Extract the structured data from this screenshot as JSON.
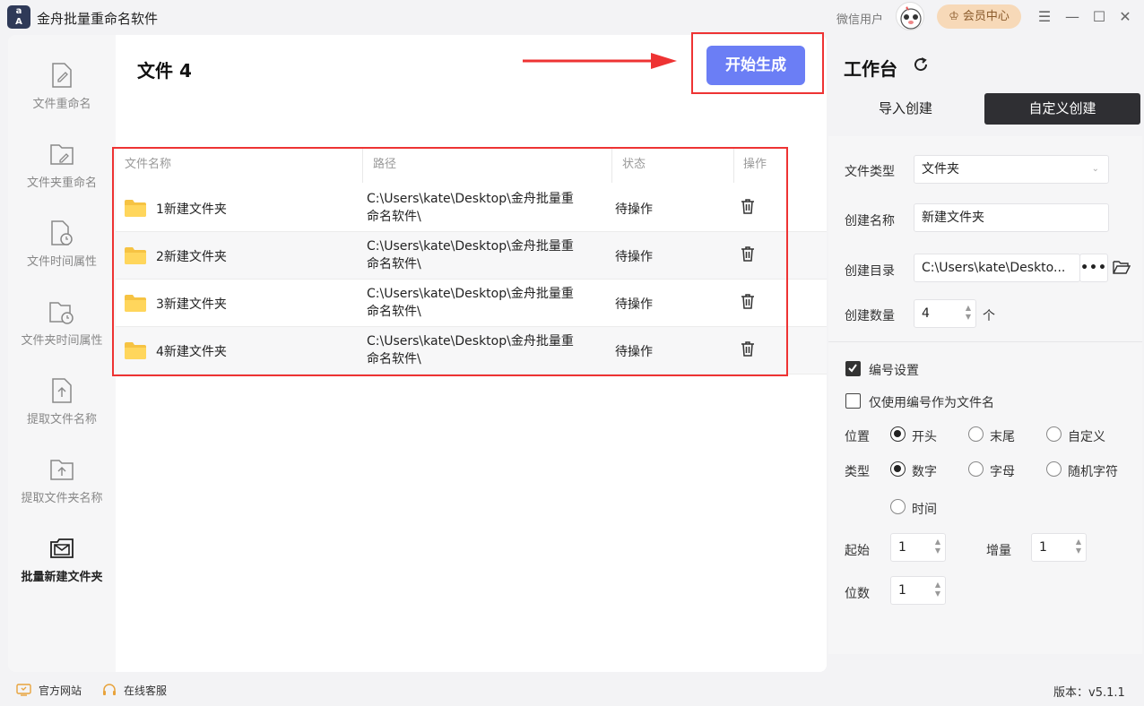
{
  "app": {
    "logo_text": "a\nA",
    "title": "金舟批量重命名软件"
  },
  "header": {
    "user_label": "微信用户",
    "vip_label": "会员中心"
  },
  "sidebar": {
    "items": [
      {
        "label": "文件重命名",
        "icon": "file-edit-icon"
      },
      {
        "label": "文件夹重命名",
        "icon": "folder-edit-icon"
      },
      {
        "label": "文件时间属性",
        "icon": "file-clock-icon"
      },
      {
        "label": "文件夹时间属性",
        "icon": "folder-clock-icon"
      },
      {
        "label": "提取文件名称",
        "icon": "file-extract-icon"
      },
      {
        "label": "提取文件夹名称",
        "icon": "folder-extract-icon"
      },
      {
        "label": "批量新建文件夹",
        "icon": "folder-mail-icon",
        "active": true
      }
    ]
  },
  "main": {
    "title": "文件 4",
    "start_button": "开始生成",
    "columns": [
      "文件名称",
      "路径",
      "状态",
      "操作"
    ],
    "rows": [
      {
        "name": "1新建文件夹",
        "path1": "C:\\Users\\kate\\Desktop\\金舟批量重",
        "path2": "命名软件\\",
        "status": "待操作"
      },
      {
        "name": "2新建文件夹",
        "path1": "C:\\Users\\kate\\Desktop\\金舟批量重",
        "path2": "命名软件\\",
        "status": "待操作"
      },
      {
        "name": "3新建文件夹",
        "path1": "C:\\Users\\kate\\Desktop\\金舟批量重",
        "path2": "命名软件\\",
        "status": "待操作"
      },
      {
        "name": "4新建文件夹",
        "path1": "C:\\Users\\kate\\Desktop\\金舟批量重",
        "path2": "命名软件\\",
        "status": "待操作"
      }
    ]
  },
  "workspace": {
    "title": "工作台",
    "tab_import": "导入创建",
    "tab_custom": "自定义创建",
    "file_type_label": "文件类型",
    "file_type_value": "文件夹",
    "create_name_label": "创建名称",
    "create_name_value": "新建文件夹",
    "create_dir_label": "创建目录",
    "create_dir_value": "C:\\Users\\kate\\Deskto...",
    "create_count_label": "创建数量",
    "create_count_value": "4",
    "count_unit": "个",
    "numbering_label": "编号设置",
    "numbering_checked": true,
    "only_number_label": "仅使用编号作为文件名",
    "only_number_checked": false,
    "position_label": "位置",
    "position_options": [
      "开头",
      "末尾",
      "自定义"
    ],
    "position_selected": "开头",
    "type_label": "类型",
    "type_options": [
      "数字",
      "字母",
      "随机字符",
      "时间"
    ],
    "type_selected": "数字",
    "start_label": "起始",
    "start_value": "1",
    "increment_label": "增量",
    "increment_value": "1",
    "digits_label": "位数",
    "digits_value": "1"
  },
  "footer": {
    "website": "官方网站",
    "support": "在线客服",
    "version": "版本：v5.1.1"
  },
  "colors": {
    "accent": "#6b7ef5",
    "highlight": "#e33333",
    "dark_tab": "#2f2f33"
  }
}
